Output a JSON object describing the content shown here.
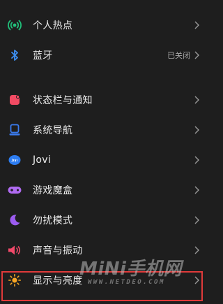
{
  "colors": {
    "background": "#1e1e1e",
    "text": "#ececec",
    "value_text": "#a9a9a9",
    "chevron": "#9a9a9a",
    "highlight_border": "#e03a3a"
  },
  "top_group": {
    "items": [
      {
        "label": "个人热点",
        "icon": "hotspot-icon",
        "icon_color": "#21c07a"
      },
      {
        "label": "蓝牙",
        "icon": "bluetooth-icon",
        "icon_color": "#3d8ef0",
        "value": "已关闭"
      }
    ]
  },
  "main_group": {
    "items": [
      {
        "label": "状态栏与通知",
        "icon": "notification-icon",
        "icon_color": "#f24b63"
      },
      {
        "label": "系统导航",
        "icon": "navigation-icon",
        "icon_color": "#3b7cf0"
      },
      {
        "label": "Jovi",
        "icon": "jovi-icon",
        "icon_color": "#2d7df2"
      },
      {
        "label": "游戏魔盒",
        "icon": "gamepad-icon",
        "icon_color": "#b06bf2"
      },
      {
        "label": "勿扰模式",
        "icon": "moon-icon",
        "icon_color": "#9c5cf0"
      },
      {
        "label": "声音与振动",
        "icon": "speaker-icon",
        "icon_color": "#f2496a"
      },
      {
        "label": "显示与亮度",
        "icon": "brightness-icon",
        "icon_color": "#f5a524"
      }
    ]
  },
  "watermark": {
    "title": "MiNi手机网",
    "url": "WWW.NETDEO.COM"
  }
}
